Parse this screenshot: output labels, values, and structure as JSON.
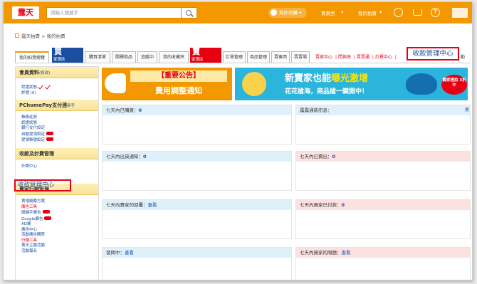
{
  "topbar": {
    "logo": "露天",
    "search_placeholder": "請輸入關鍵字",
    "overseas": "海外代購",
    "nav_seller": "賣東西",
    "nav_account": "我的拍賣"
  },
  "breadcrumb": "露天拍賣 > 我的拍賣",
  "tabs": {
    "my_summary": "我的拍賣總覽",
    "buyer_tag": "買",
    "buyer_tag_sub": "家專區",
    "buy_list": "購買清單",
    "tracked": "關標商品",
    "auction": "追蹤中",
    "my_evaluation": "我的收藏夾",
    "seller_tag": "賣",
    "seller_tag_sub": "家專區",
    "order_mgmt": "訂單管理",
    "product_mgmt": "商品管理",
    "sell_item": "賣東西",
    "my_store": "賣賣場"
  },
  "right_links": [
    "賣家中心",
    "問與答",
    "賣賣通",
    "計費中心"
  ],
  "receipt_center_label": "收款管理中心",
  "overflow_link": "動",
  "sidebar": {
    "member_title": "會員資料",
    "member_edit": "(修改)",
    "member_links": [
      "認證狀態",
      "評價 (0)"
    ],
    "pchome_title": "PChomePay支付連",
    "pchome_sub": "新手",
    "pchome_links": [
      "帳務註冊",
      "認證狀態",
      "銀行支付設定",
      "自動提領設定",
      "提領帳號設定"
    ],
    "billing_title": "收款及計費管理",
    "billing_links": [
      "計費中心",
      "收款管理中心"
    ],
    "marketing_title": "賣家行銷管理",
    "marketing_links": [
      "賣場獎勵方案",
      "廣告工具",
      "關鍵字廣告",
      "Google廣告",
      "AD廣",
      "廣告中心",
      "活動廣告購買",
      "行銷工具",
      "賣天主題活動",
      "活動報名"
    ]
  },
  "banners": {
    "announce_title": "【重要公告】",
    "announce_sub": "費用調整通知",
    "promo_title_a": "新賣家也能",
    "promo_title_b": "曝光激增",
    "promo_sub": "花花搶海，商品搶一鍵開中！",
    "promo_badge": "賣家搭拍 3折中"
  },
  "panels": {
    "bought_label": "七天內已購買：",
    "bought_value": "0",
    "news_label": "露露通新訊息：",
    "news_more": "更",
    "ship_label": "七天內出貨通知：",
    "ship_value": "0",
    "sold_label": "七天內已賣出：",
    "sold_value": "0",
    "reply_label": "七天內賣家的回覆：",
    "reply_link": "查看",
    "paid_label": "七天內買家已付款：",
    "paid_value": "0",
    "asking_label": "發問中：",
    "asking_link": "查看",
    "question_label": "七天內買家的問題：",
    "question_link": "查看"
  }
}
